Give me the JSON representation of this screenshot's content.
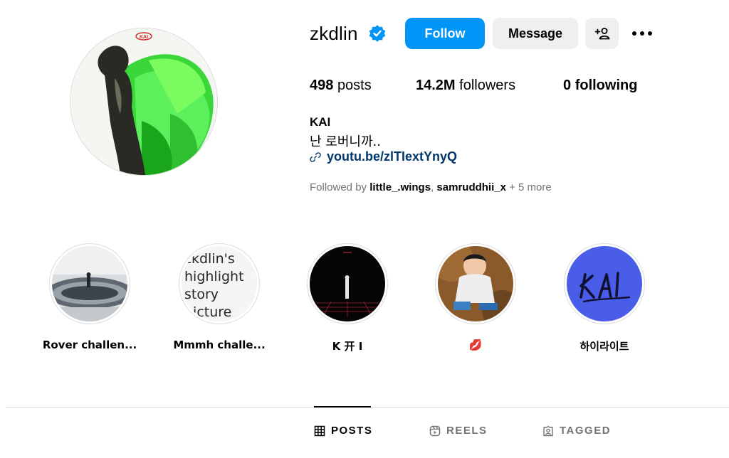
{
  "profile": {
    "username": "zkdlin",
    "verified_icon": "verified-badge-icon",
    "buttons": {
      "follow": "Follow",
      "message": "Message",
      "add_user_icon": "add-user-icon",
      "more_icon": "more-options-icon"
    },
    "stats": {
      "posts_count": "498",
      "posts_label": "posts",
      "followers_count": "14.2M",
      "followers_label": "followers",
      "following_count": "0",
      "following_label": "following"
    },
    "full_name": "KAI",
    "bio": "난 로버니까..",
    "link": "youtu.be/zlTIextYnyQ",
    "followed_by": {
      "prefix": "Followed by",
      "users": [
        "little_.wings",
        "samruddhii_x"
      ],
      "more": "+ 5 more"
    },
    "avatar_badge": "KAI"
  },
  "highlights": [
    {
      "label": "Rover challen..."
    },
    {
      "label": "Mmmh challe...",
      "broken_alt": "zkdlin's highlight story picture"
    },
    {
      "label": "K 开 I"
    },
    {
      "label": "💋"
    },
    {
      "label": "하이라이트"
    }
  ],
  "tabs": [
    {
      "label": "POSTS",
      "icon": "grid-icon",
      "active": true
    },
    {
      "label": "REELS",
      "icon": "reels-icon",
      "active": false
    },
    {
      "label": "TAGGED",
      "icon": "tagged-icon",
      "active": false
    }
  ],
  "colors": {
    "accent": "#0095f6",
    "link": "#00376b",
    "muted": "#737373",
    "verified": "#0095f6"
  }
}
